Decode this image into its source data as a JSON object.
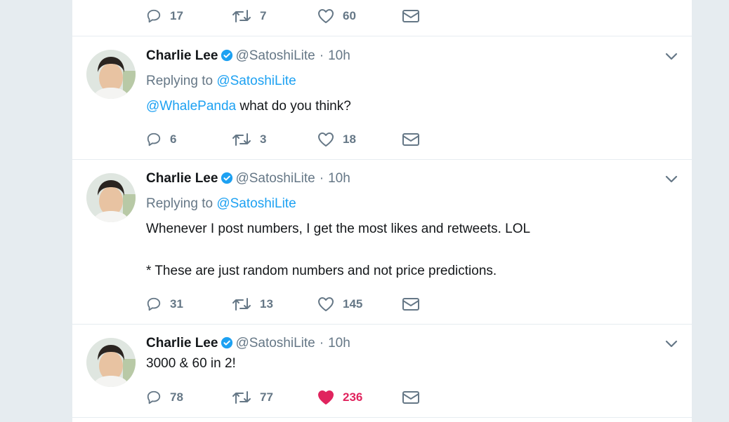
{
  "colors": {
    "link": "#1da1f2",
    "muted": "#657786",
    "liked": "#e0245e",
    "verified": "#1da1f2"
  },
  "icons": {
    "reply": "speech-bubble",
    "retweet": "retweet-arrows",
    "like": "heart",
    "dm": "envelope",
    "verified": "verified-badge",
    "caret": "chevron-down"
  },
  "top_actions": {
    "replies": "17",
    "retweets": "7",
    "likes": "60"
  },
  "tweets": [
    {
      "name": "Charlie Lee",
      "handle": "@SatoshiLite",
      "dot": "·",
      "time": "10h",
      "replying_prefix": "Replying to",
      "replying_handle": "@SatoshiLite",
      "mention": "@WhalePanda",
      "text": " what do you think?",
      "replies": "6",
      "retweets": "3",
      "likes": "18"
    },
    {
      "name": "Charlie Lee",
      "handle": "@SatoshiLite",
      "dot": "·",
      "time": "10h",
      "replying_prefix": "Replying to",
      "replying_handle": "@SatoshiLite",
      "text_line1": "Whenever I post numbers, I get the most likes and retweets. LOL",
      "text_line2": "* These are just random numbers and not price predictions.",
      "replies": "31",
      "retweets": "13",
      "likes": "145"
    },
    {
      "name": "Charlie Lee",
      "handle": "@SatoshiLite",
      "dot": "·",
      "time": "10h",
      "text": "3000 & 60 in 2!",
      "replies": "78",
      "retweets": "77",
      "likes": "236",
      "liked": true
    }
  ]
}
